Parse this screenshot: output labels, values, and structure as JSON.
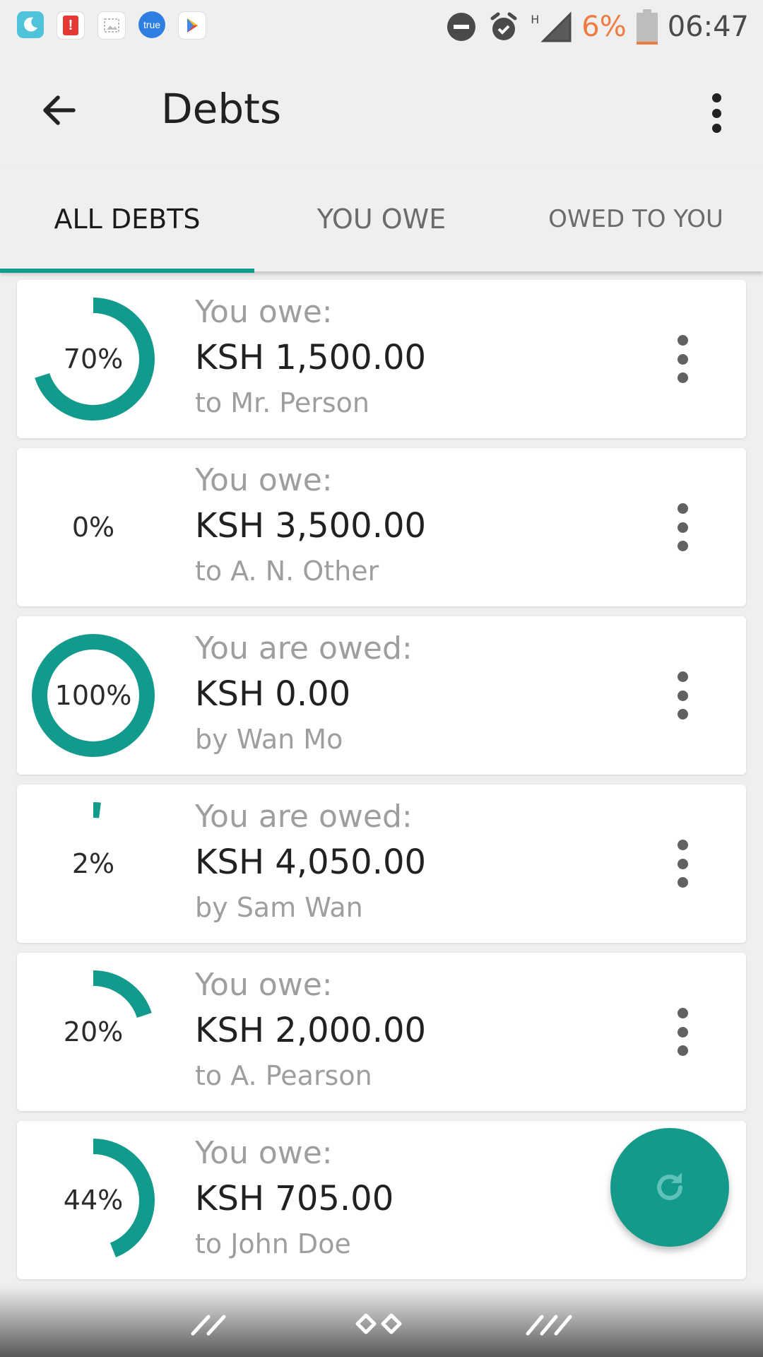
{
  "status_bar": {
    "battery_percent": "6%",
    "time": "06:47",
    "network_label": "H",
    "app_badge_text": "true"
  },
  "app_bar": {
    "title": "Debts"
  },
  "tabs": [
    {
      "label": "ALL DEBTS",
      "active": true
    },
    {
      "label": "YOU OWE",
      "active": false
    },
    {
      "label": "OWED TO YOU",
      "active": false
    }
  ],
  "debts": [
    {
      "percent_label": "70%",
      "percent": 70,
      "label": "You owe:",
      "amount": "KSH 1,500.00",
      "party": "to Mr. Person"
    },
    {
      "percent_label": "0%",
      "percent": 0,
      "label": "You owe:",
      "amount": "KSH 3,500.00",
      "party": "to A. N. Other"
    },
    {
      "percent_label": "100%",
      "percent": 100,
      "label": "You are owed:",
      "amount": "KSH 0.00",
      "party": "by Wan Mo"
    },
    {
      "percent_label": "2%",
      "percent": 2,
      "label": "You are owed:",
      "amount": "KSH 4,050.00",
      "party": "by Sam Wan"
    },
    {
      "percent_label": "20%",
      "percent": 20,
      "label": "You owe:",
      "amount": "KSH 2,000.00",
      "party": "to A. Pearson"
    },
    {
      "percent_label": "44%",
      "percent": 44,
      "label": "You owe:",
      "amount": "KSH 705.00",
      "party": "to John Doe"
    }
  ],
  "colors": {
    "accent": "#129a8c",
    "battery_low": "#f07b3f"
  },
  "icons": {
    "back": "arrow-back-icon",
    "overflow": "more-vert-icon",
    "fab": "refresh-icon"
  }
}
